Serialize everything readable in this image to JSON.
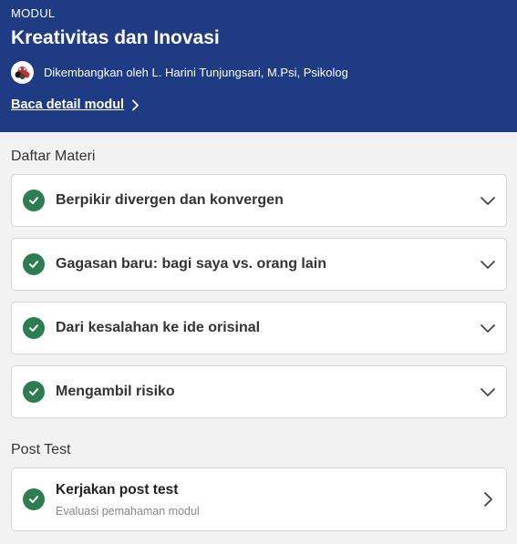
{
  "header": {
    "eyebrow": "MODUL",
    "title": "Kreativitas dan Inovasi",
    "author": "Dikembangkan oleh L. Harini Tunjungsari, M.Psi, Psikolog",
    "detail_link": "Baca detail modul",
    "background_color": "#1e3b83"
  },
  "materials": {
    "section_title": "Daftar Materi",
    "items": [
      {
        "label": "Berpikir divergen dan konvergen",
        "completed": true
      },
      {
        "label": "Gagasan baru: bagi saya vs. orang lain",
        "completed": true
      },
      {
        "label": "Dari kesalahan ke ide orisinal",
        "completed": true
      },
      {
        "label": "Mengambil risiko",
        "completed": true
      }
    ]
  },
  "post_test": {
    "section_title": "Post Test",
    "title": "Kerjakan post test",
    "subtitle": "Evaluasi pemahaman modul",
    "completed": true
  },
  "colors": {
    "check_green": "#2e7d52",
    "page_background": "#f2f2f2"
  },
  "icons": {
    "check": "check-circle-icon",
    "expand": "chevron-down-icon",
    "go": "chevron-right-icon"
  }
}
